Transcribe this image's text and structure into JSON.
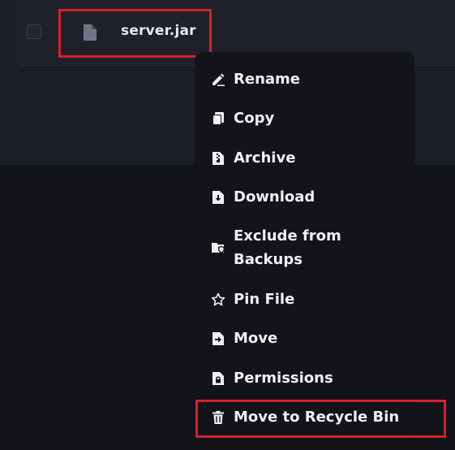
{
  "file": {
    "name": "server.jar",
    "icon": "file-icon"
  },
  "context_menu": {
    "items": [
      {
        "label": "Rename",
        "icon": "pencil-icon"
      },
      {
        "label": "Copy",
        "icon": "copy-icon"
      },
      {
        "label": "Archive",
        "icon": "archive-icon"
      },
      {
        "label": "Download",
        "icon": "download-icon"
      },
      {
        "label": "Exclude from Backups",
        "icon": "folder-shield-icon"
      },
      {
        "label": "Pin File",
        "icon": "star-icon"
      },
      {
        "label": "Move",
        "icon": "move-icon"
      },
      {
        "label": "Permissions",
        "icon": "lock-file-icon"
      },
      {
        "label": "Move to Recycle Bin",
        "icon": "trash-icon"
      }
    ]
  },
  "colors": {
    "highlight": "#d6202a",
    "menu_background": "#121419",
    "row_background": "#1e2129",
    "text": "#eef0f3"
  }
}
